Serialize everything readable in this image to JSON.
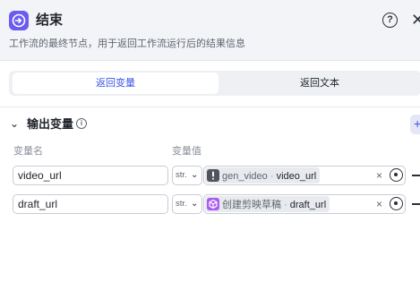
{
  "header": {
    "title": "结束",
    "description": "工作流的最终节点，用于返回工作流运行后的结果信息",
    "accent_color": "#6b5cf0"
  },
  "tabs": [
    {
      "label": "返回变量",
      "active": true
    },
    {
      "label": "返回文本",
      "active": false
    }
  ],
  "output_section": {
    "title": "输出变量",
    "info_icon": "info-icon",
    "add_icon": "plus-icon"
  },
  "columns": {
    "name": "变量名",
    "value": "变量值"
  },
  "rows": [
    {
      "name": "video_url",
      "type": "str.",
      "ref_node": "gen_video",
      "ref_sep": " · ",
      "ref_var": "video_url",
      "node_icon": "alert-icon",
      "node_icon_color": "#50545c"
    },
    {
      "name": "draft_url",
      "type": "str.",
      "ref_node": "创建剪映草稿",
      "ref_sep": " · ",
      "ref_var": "draft_url",
      "node_icon": "cube-icon",
      "node_icon_color": "#a85cf0"
    }
  ]
}
